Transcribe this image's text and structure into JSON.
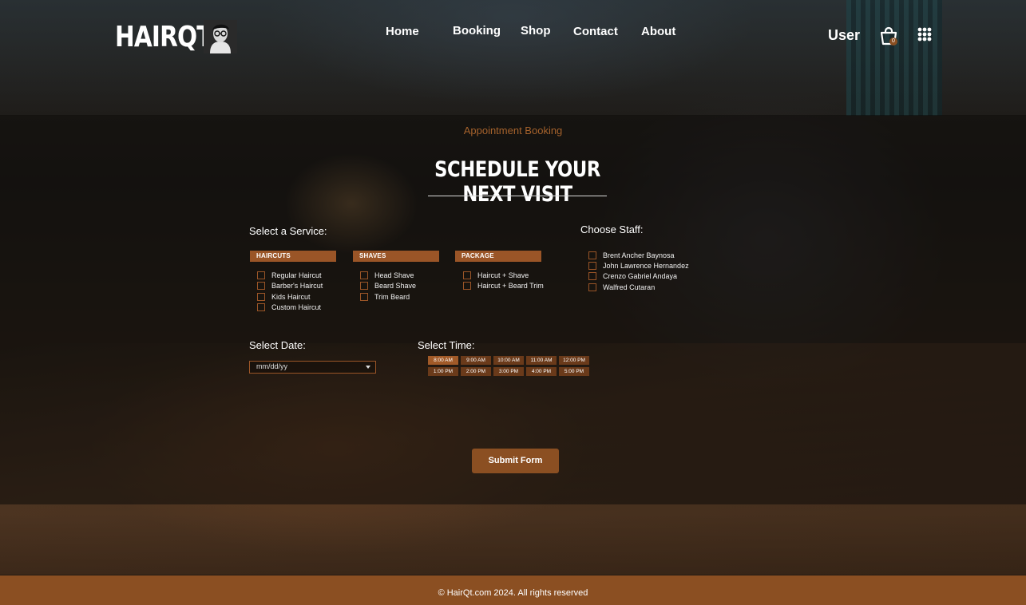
{
  "brand": {
    "logo_text": "HAIRQT"
  },
  "nav": {
    "home": "Home",
    "booking": "Booking",
    "shop": "Shop",
    "contact": "Contact",
    "about": "About"
  },
  "header": {
    "user_label": "User",
    "cart_count": "0",
    "cart_icon": "shopping-bag-icon",
    "menu_icon": "grid-dots-icon"
  },
  "booking": {
    "eyebrow": "Appointment Booking",
    "title": "SCHEDULE YOUR NEXT VISIT",
    "service_label": "Select a Service:",
    "staff_label": "Choose Staff:",
    "date_label": "Select Date:",
    "time_label": "Select Time:",
    "date_placeholder": "mm/dd/yy",
    "submit_label": "Submit Form"
  },
  "services": {
    "haircuts": {
      "heading": "HAIRCUTS",
      "options": [
        "Regular Haircut",
        "Barber's Haircut",
        "Kids Haircut",
        "Custom Haircut"
      ]
    },
    "shaves": {
      "heading": "SHAVES",
      "options": [
        "Head Shave",
        "Beard Shave",
        "Trim Beard"
      ]
    },
    "package": {
      "heading": "PACKAGE",
      "options": [
        "Haircut + Shave",
        "Haircut + Beard Trim"
      ]
    }
  },
  "staff": [
    "Brent Ancher Baynosa",
    "John Lawrence Hernandez",
    "Crenzo Gabriel Andaya",
    "Walfred Cutaran"
  ],
  "time_slots": {
    "row1": [
      "8:00 AM",
      "9:00 AM",
      "10:00 AM",
      "11:00 AM",
      "12:00 PM"
    ],
    "row2": [
      "1:00 PM",
      "2:00 PM",
      "3:00 PM",
      "4:00 PM",
      "5:00 PM"
    ],
    "selected": "8:00 AM"
  },
  "footer": {
    "copyright": "© HairQt.com 2024. All rights reserved"
  },
  "colors": {
    "accent": "#8b4f22",
    "accent_light": "#a5622c"
  }
}
